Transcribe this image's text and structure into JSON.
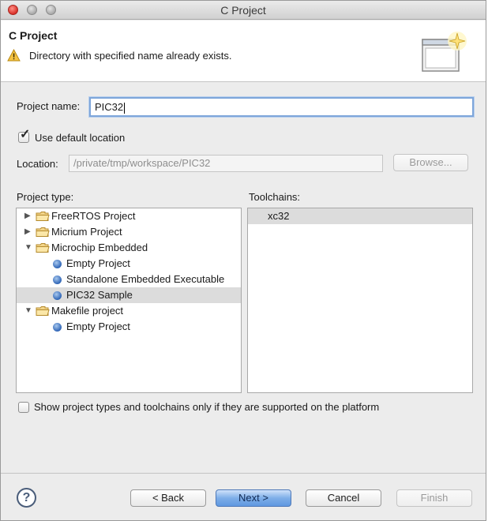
{
  "window": {
    "title": "C Project"
  },
  "header": {
    "title": "C Project",
    "message": "Directory with specified name already exists.",
    "warning_icon": "warning-icon",
    "banner_icon": "new-project-wizard-icon"
  },
  "form": {
    "project_name_label": "Project name:",
    "project_name_value": "PIC32",
    "use_default_location_label": "Use default location",
    "use_default_location_checked": true,
    "location_label": "Location:",
    "location_value": "/private/tmp/workspace/PIC32",
    "browse_label": "Browse..."
  },
  "project_types": {
    "label": "Project type:",
    "items": [
      {
        "label": "FreeRTOS Project",
        "kind": "folder",
        "expanded": false,
        "level": 0,
        "selected": false
      },
      {
        "label": "Micrium Project",
        "kind": "folder",
        "expanded": false,
        "level": 0,
        "selected": false
      },
      {
        "label": "Microchip Embedded",
        "kind": "folder",
        "expanded": true,
        "level": 0,
        "selected": false
      },
      {
        "label": "Empty Project",
        "kind": "leaf",
        "level": 1,
        "selected": false
      },
      {
        "label": "Standalone Embedded Executable",
        "kind": "leaf",
        "level": 1,
        "selected": false
      },
      {
        "label": "PIC32 Sample",
        "kind": "leaf",
        "level": 1,
        "selected": true
      },
      {
        "label": "Makefile project",
        "kind": "folder",
        "expanded": true,
        "level": 0,
        "selected": false
      },
      {
        "label": "Empty Project",
        "kind": "leaf",
        "level": 1,
        "selected": false
      }
    ]
  },
  "toolchains": {
    "label": "Toolchains:",
    "items": [
      {
        "label": "xc32",
        "selected": true
      }
    ]
  },
  "filter": {
    "label": "Show project types and toolchains only if they are supported on the platform",
    "checked": false
  },
  "buttons": {
    "help": "?",
    "back": "< Back",
    "next": "Next >",
    "cancel": "Cancel",
    "finish": "Finish"
  }
}
